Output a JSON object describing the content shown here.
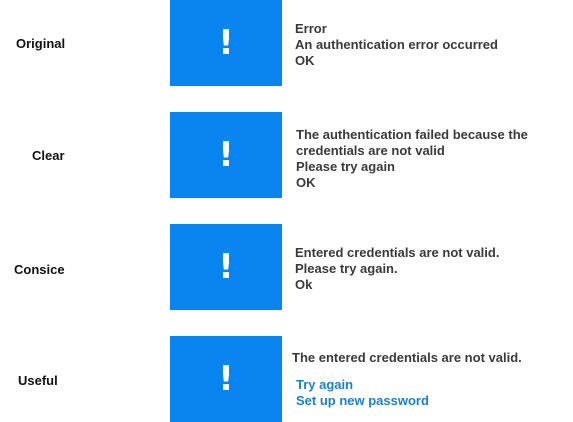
{
  "rows": [
    {
      "label": "Original",
      "title": "Error",
      "lines": [
        "An authentication error occurred"
      ],
      "action": "OK"
    },
    {
      "label": "Clear",
      "lines": [
        "The authentication failed because the",
        "credentials are not valid",
        "Please try again"
      ],
      "action": "OK"
    },
    {
      "label": "Consice",
      "lines": [
        "Entered credentials are not valid.",
        "Please try again."
      ],
      "action": "Ok"
    },
    {
      "label": "Useful",
      "lines": [
        "The entered credentials are not valid."
      ],
      "links": [
        "Try again",
        "Set up new password"
      ]
    }
  ],
  "icon": {
    "glyph": "!",
    "name": "exclamation-icon",
    "box_color": "#0a84ee",
    "link_color": "#1a7fd4"
  }
}
